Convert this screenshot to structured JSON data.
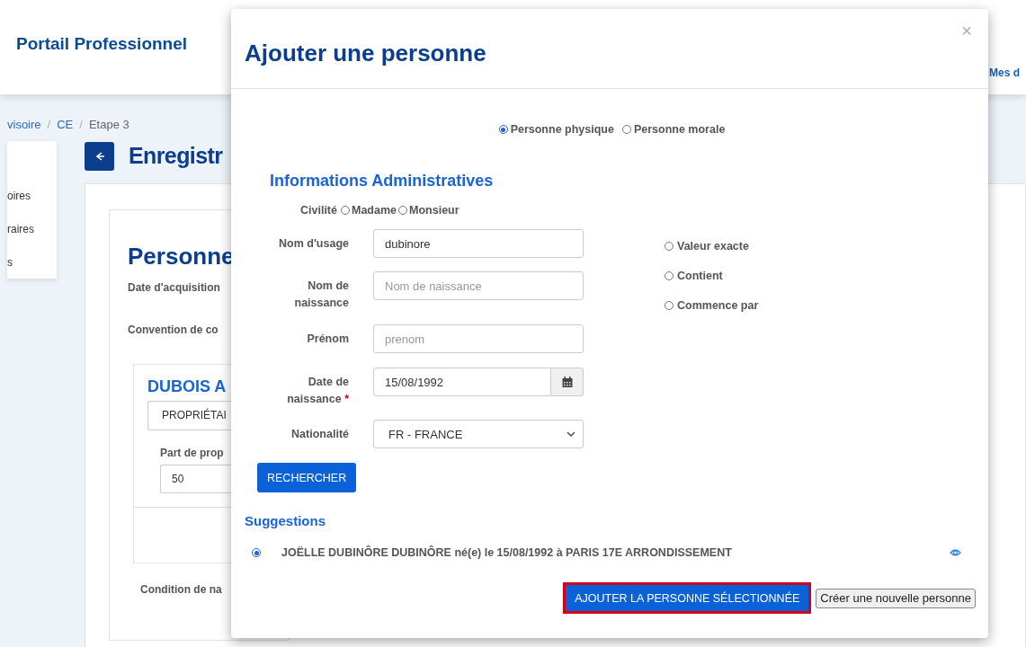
{
  "header": {
    "brand": "Portail Professionnel",
    "nav_link": "Mes d"
  },
  "breadcrumb": [
    {
      "kind": "link",
      "label": "visoire"
    },
    {
      "kind": "separator",
      "label": "/"
    },
    {
      "kind": "link",
      "label": "CE"
    },
    {
      "kind": "separator",
      "label": "/"
    },
    {
      "kind": "current",
      "label": "Etape 3"
    }
  ],
  "side_menu": {
    "items": [
      "oires",
      "raires",
      "s"
    ]
  },
  "page": {
    "title": "Enregistr"
  },
  "section": {
    "title": "Personne",
    "fields": [
      "Date d'acquisition",
      "Convention de co"
    ],
    "owner": {
      "name": "DUBOIS A",
      "role": "PROPRIÉTAI",
      "share_label": "Part de prop",
      "share_value": "50"
    },
    "footer_label": "Condition de na"
  },
  "dialog": {
    "title": "Ajouter une personne",
    "close": "×",
    "person_types": [
      {
        "label": "Personne physique",
        "selected": true
      },
      {
        "label": "Personne morale",
        "selected": false
      }
    ],
    "section_title": "Informations Administratives",
    "civility": {
      "label": "Civilité",
      "options": [
        {
          "label": "Madame",
          "selected": false
        },
        {
          "label": "Monsieur",
          "selected": false
        }
      ]
    },
    "fields": [
      {
        "kind": "text",
        "label": "Nom d'usage",
        "value": "dubinore"
      },
      {
        "kind": "text",
        "label": "Nom de naissance",
        "placeholder": "Nom de naissance"
      },
      {
        "kind": "text",
        "label": "Prénom",
        "placeholder": "prenom"
      },
      {
        "kind": "date",
        "label": "Date de naissance",
        "required_mark": "*",
        "value": "15/08/1992"
      },
      {
        "kind": "select",
        "label": "Nationalité",
        "value": "FR - FRANCE"
      }
    ],
    "match_modes": [
      {
        "label": "Valeur exacte",
        "selected": false
      },
      {
        "label": "Contient",
        "selected": false
      },
      {
        "label": "Commence par",
        "selected": false
      }
    ],
    "search_button": "RECHERCHER",
    "suggestions_title": "Suggestions",
    "suggestions": [
      {
        "label": "JOËLLE DUBINÔRE DUBINÔRE né(e) le 15/08/1992 à PARIS 17E ARRONDISSEMENT",
        "selected": true
      }
    ],
    "buttons": [
      {
        "kind": "primary",
        "label": "AJOUTER LA PERSONNE SÉLECTIONNÉE",
        "focused": true
      },
      {
        "kind": "secondary",
        "label": "Créer une nouvelle personne",
        "focused": false
      }
    ]
  }
}
